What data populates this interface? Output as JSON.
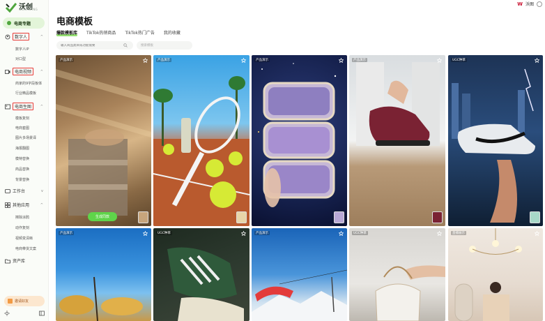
{
  "app": {
    "name": "沃创",
    "subtitle": "WOCHUANG"
  },
  "topbar": {
    "brand_mark": "W",
    "brand_name": "沃图"
  },
  "sidebar": {
    "active_item": "电商专题",
    "groups": [
      {
        "label": "数字人",
        "items": [
          "数字人IP",
          "对口型"
        ]
      },
      {
        "label": "电商视频",
        "items": [
          "商家的9字段板体",
          "行业精品模板"
        ]
      },
      {
        "label": "电商生图",
        "items": [
          "模板复刻",
          "电商套图",
          "图片多场景译",
          "海报翻图",
          "模特替换",
          "商品替换",
          "背景替换"
        ]
      },
      {
        "label": "工作台",
        "items": []
      },
      {
        "label": "其他应用",
        "items": [
          "擦除涂鸦",
          "动作复刻",
          "视频变清晰",
          "电商带货文案"
        ]
      },
      {
        "label": "资产库",
        "items": []
      }
    ],
    "invite_label": "邀请好友"
  },
  "main": {
    "title": "电商模板",
    "tabs": [
      "爆款模板库",
      "TikTok热销商品",
      "TikTok热门广告",
      "我的收藏"
    ],
    "search_placeholder": "输入商品类目或功能需要",
    "select_placeholder": "搜索模板",
    "generate_label": "生成同款",
    "cards": [
      {
        "tag": "产品演示"
      },
      {
        "tag": "产品演示"
      },
      {
        "tag": "产品演示"
      },
      {
        "tag": "产品演示"
      },
      {
        "tag": "UGC种草"
      },
      {
        "tag": "产品演示"
      },
      {
        "tag": "UGC种草"
      },
      {
        "tag": "产品演示"
      },
      {
        "tag": "UGC种草"
      },
      {
        "tag": "直播展示"
      }
    ]
  },
  "colors": {
    "accent": "#5fd44a",
    "active_bg": "#e3f5d9",
    "highlight_box": "#e53935"
  }
}
